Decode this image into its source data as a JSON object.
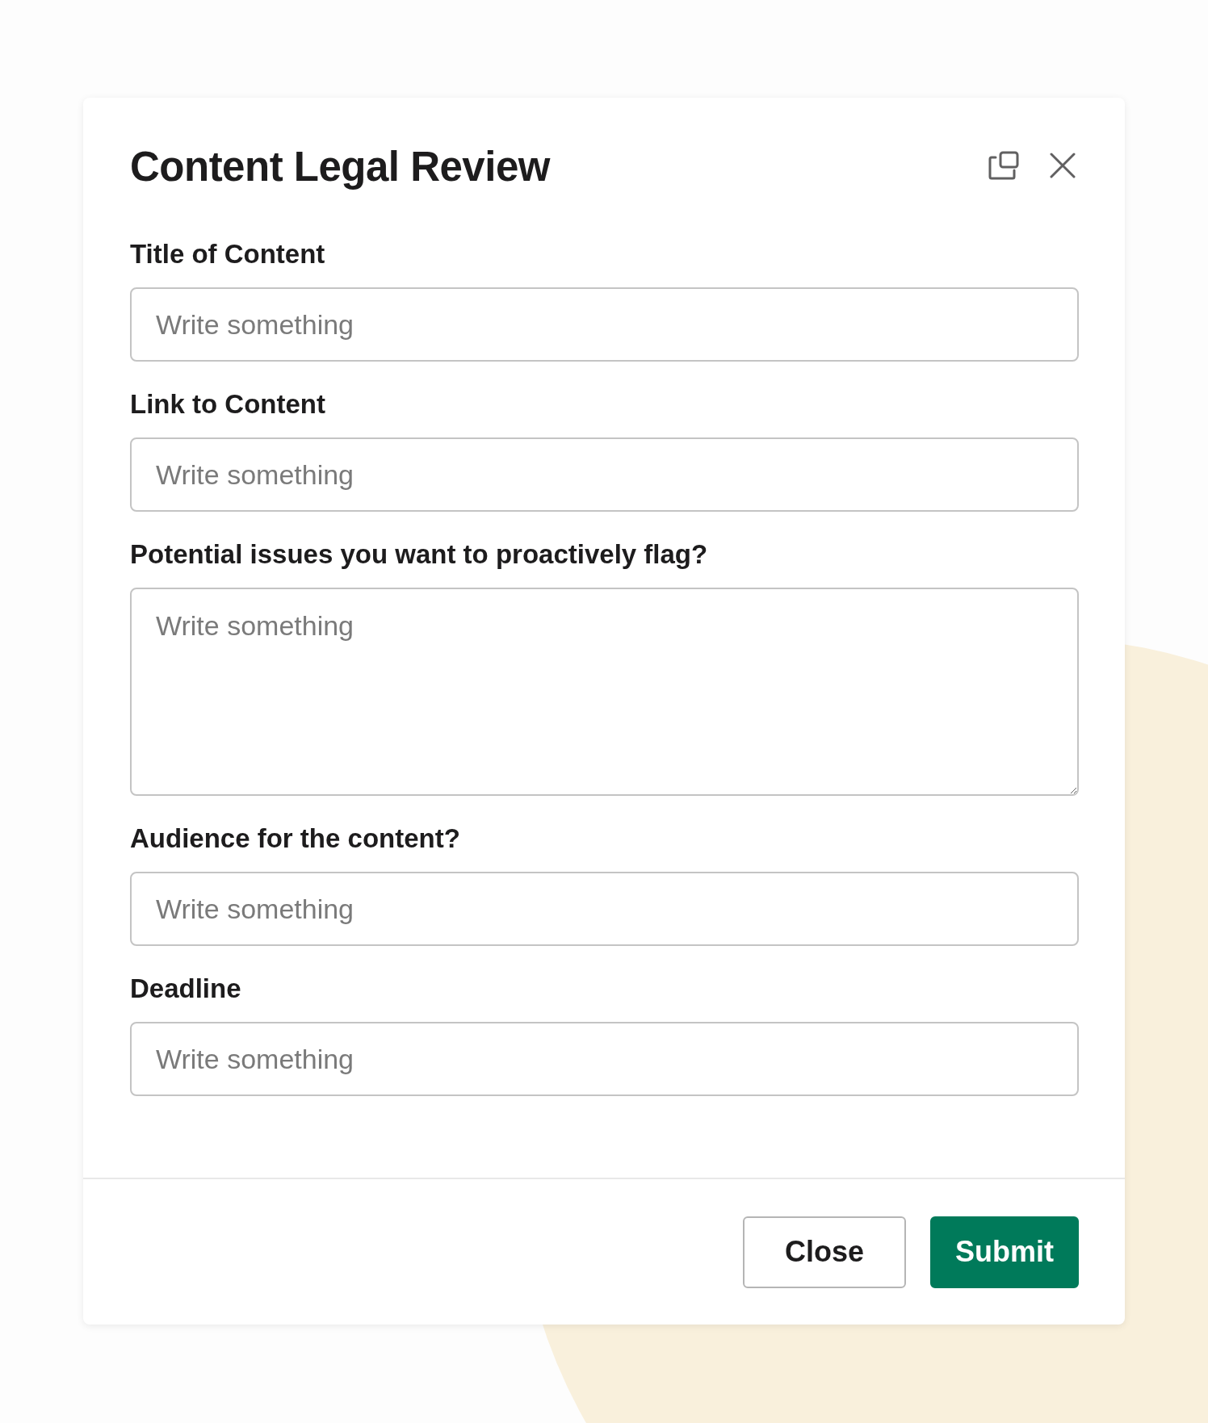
{
  "dialog": {
    "title": "Content Legal Review"
  },
  "fields": [
    {
      "label": "Title of Content",
      "kind": "input",
      "placeholder": "Write something"
    },
    {
      "label": "Link to Content",
      "kind": "input",
      "placeholder": "Write something"
    },
    {
      "label": "Potential issues you want to proactively flag?",
      "kind": "textarea",
      "placeholder": "Write something"
    },
    {
      "label": "Audience for the content?",
      "kind": "input",
      "placeholder": "Write something"
    },
    {
      "label": "Deadline",
      "kind": "input",
      "placeholder": "Write something"
    }
  ],
  "buttons": [
    {
      "label": "Close",
      "kind": "secondary"
    },
    {
      "label": "Submit",
      "kind": "primary"
    }
  ]
}
